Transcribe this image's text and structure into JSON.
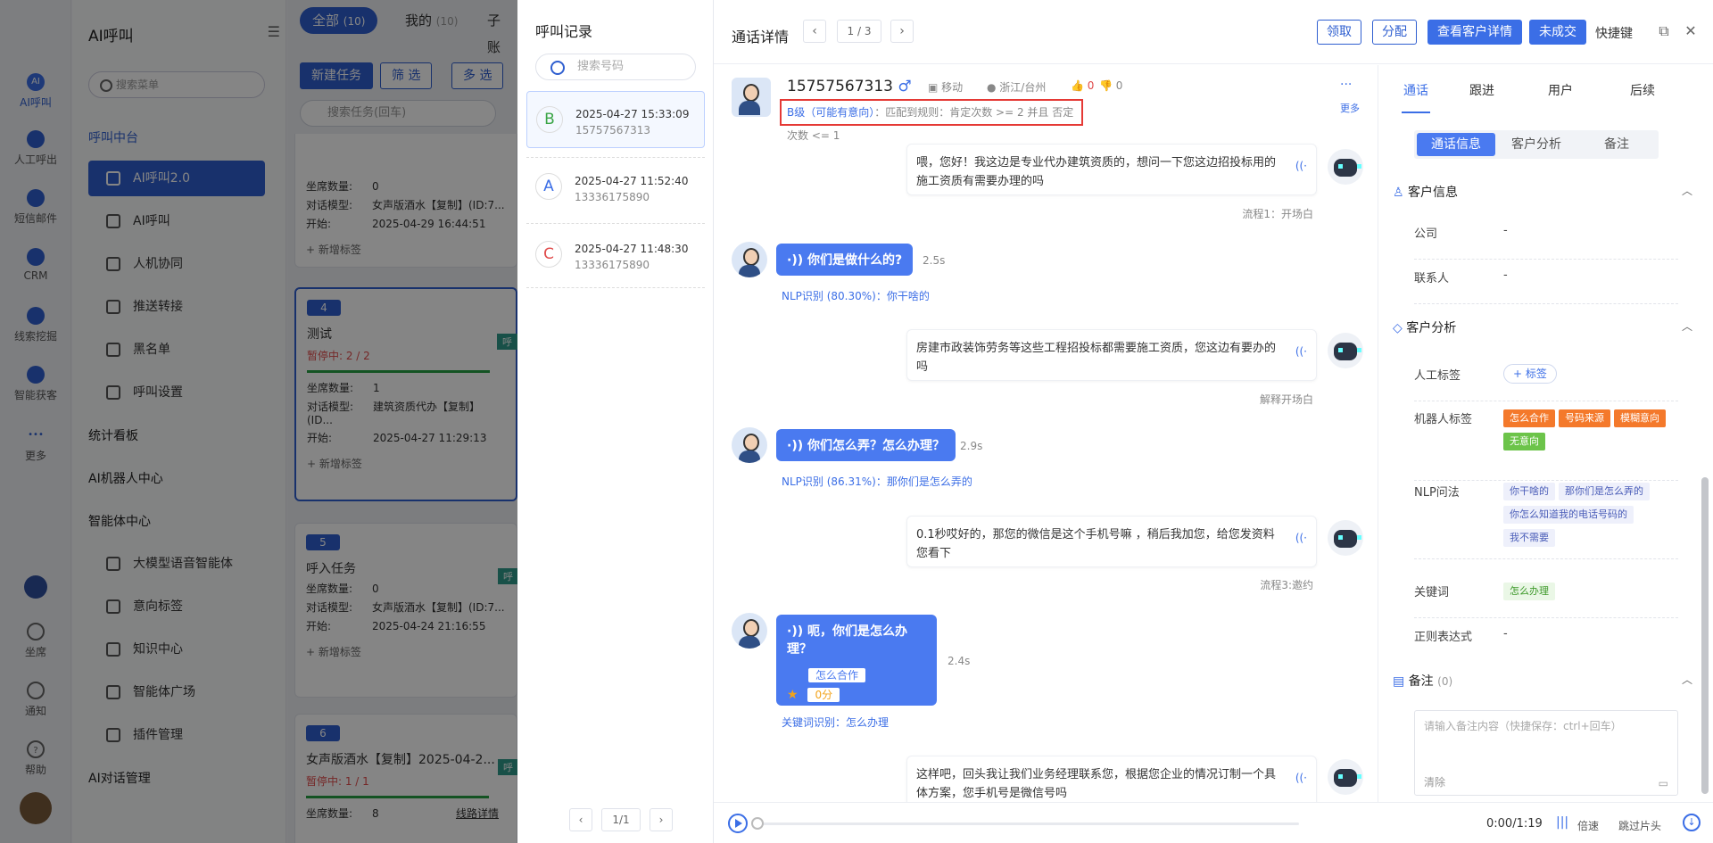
{
  "rail": {
    "items": [
      {
        "label": "AI呼叫",
        "active": true
      },
      {
        "label": "人工呼出"
      },
      {
        "label": "短信邮件"
      },
      {
        "label": "CRM"
      },
      {
        "label": "线索挖掘"
      },
      {
        "label": "智能获客"
      },
      {
        "label": "更多"
      },
      {
        "label": "坐席"
      },
      {
        "label": "通知"
      },
      {
        "label": "帮助"
      }
    ]
  },
  "nav": {
    "title": "AI呼叫",
    "search_placeholder": "搜索菜单",
    "group1": "呼叫中台",
    "items1": [
      "AI呼叫2.0",
      "AI呼叫",
      "人机协同",
      "推送转接",
      "黑名单",
      "呼叫设置"
    ],
    "group2": "统计看板",
    "group3": "AI机器人中心",
    "group4": "智能体中心",
    "items4": [
      "大模型语音智能体",
      "意向标签",
      "知识中心",
      "智能体广场",
      "插件管理"
    ],
    "group5": "AI对话管理"
  },
  "tasks": {
    "tab_all": "全部",
    "tab_all_count": "(10)",
    "tab_mine": "我的",
    "tab_mine_count": "(10)",
    "tab_sub": "子账",
    "btn_new": "新建任务",
    "btn_filter": "筛 选",
    "btn_multi": "多 选",
    "search_placeholder": "搜索任务(回车)",
    "card0": {
      "seats_label": "坐席数量:",
      "seats": "0",
      "model_label": "对话模型:",
      "model": "女声版酒水【复制】(ID:7...",
      "start_label": "开始:",
      "start": "2025-04-29 16:44:51",
      "add": "+ 新增标签"
    },
    "card1": {
      "num": "4",
      "name": "测试",
      "status": "暂停中: 2 / 2",
      "seats_label": "坐席数量:",
      "seats": "1",
      "model_label": "对话模型:",
      "model": "建筑资质代办【复制】(ID...",
      "start_label": "开始:",
      "start": "2025-04-27 11:29:13",
      "add": "+ 新增标签",
      "tag": "呼"
    },
    "card2": {
      "num": "5",
      "name": "呼入任务",
      "seats_label": "坐席数量:",
      "seats": "0",
      "model_label": "对话模型:",
      "model": "女声版酒水【复制】(ID:7...",
      "start_label": "开始:",
      "start": "2025-04-24 21:16:55",
      "add": "+ 新增标签",
      "tag": "呼"
    },
    "card3": {
      "num": "6",
      "name": "女声版酒水【复制】2025-04-2...",
      "status": "暂停中: 1 / 1",
      "seats_label": "坐席数量:",
      "seats": "8",
      "link": "线路详情",
      "tag": "呼"
    }
  },
  "records": {
    "title": "呼叫记录",
    "search_placeholder": "搜索号码",
    "items": [
      {
        "grade": "B",
        "datetime": "2025-04-27 15:33:09",
        "phone": "15757567313",
        "color": "#3aa546"
      },
      {
        "grade": "A",
        "datetime": "2025-04-27 11:52:40",
        "phone": "13336175890",
        "color": "#3b6ee6"
      },
      {
        "grade": "C",
        "datetime": "2025-04-27 11:48:30",
        "phone": "13336175890",
        "color": "#e04b4b"
      }
    ],
    "page": "1/1"
  },
  "detail": {
    "title": "通话详情",
    "page": "1 / 3",
    "btn_claim": "领取",
    "btn_assign": "分配",
    "btn_customer": "查看客户详情",
    "btn_fail": "未成交",
    "shortcut": "快捷键",
    "phone": "15757567313",
    "gender": "♂",
    "carrier": "移动",
    "region": "浙江/台州",
    "likes": "0",
    "dislikes": "0",
    "more": "更多",
    "level": "B级（可能有意向）",
    "rule": "：匹配到规则：肯定次数 >= 2 并且 否定次数 <= 1"
  },
  "chat": [
    {
      "role": "bot",
      "text": "喂，您好！我这边是专业代办建筑资质的，想问一下您这边招投标用的施工资质有需要办理的吗",
      "flow": "流程1：开场白"
    },
    {
      "role": "user",
      "text": "你们是做什么的?",
      "dur": "2.5s",
      "nlp": "NLP识别 (80.30%)：你干啥的"
    },
    {
      "role": "bot",
      "text": "房建市政装饰劳务等这些工程招投标都需要施工资质，您这边有要办的吗",
      "flow": "解释开场白"
    },
    {
      "role": "user",
      "text": "你们怎么弄？怎么办理？",
      "dur": "2.9s",
      "nlp": "NLP识别 (86.31%)：那你们是怎么弄的"
    },
    {
      "role": "bot",
      "text": "0.1秒哎好的，那您的微信是这个手机号嘛 ，稍后我加您，给您发资料您看下",
      "flow": "流程3:邀约"
    },
    {
      "role": "user",
      "text": "呃，你们是怎么办理？",
      "dur": "2.4s",
      "chip": "怎么合作",
      "score": "0分",
      "nlp": "关键词识别：怎么办理"
    },
    {
      "role": "bot",
      "text": "这样吧，回头我让我们业务经理联系您，根据您企业的情况订制一个具体方案，您手机号是微信号吗"
    }
  ],
  "player": {
    "time": "0:00/1:19",
    "speed": "倍速",
    "skip": "跳过片头"
  },
  "side": {
    "tabs": [
      "通话",
      "跟进",
      "用户",
      "后续"
    ],
    "seg": [
      "通话信息",
      "客户分析",
      "备注"
    ],
    "customer_title": "客户信息",
    "company_label": "公司",
    "company": "-",
    "contact_label": "联系人",
    "contact": "-",
    "analysis_title": "客户分析",
    "manual_tag_label": "人工标签",
    "add_tag": "+ 标签",
    "robot_tag_label": "机器人标签",
    "robot_tags": [
      {
        "t": "怎么合作",
        "c": "o"
      },
      {
        "t": "号码来源",
        "c": "o"
      },
      {
        "t": "模糊意向",
        "c": "o"
      },
      {
        "t": "无意向",
        "c": "g"
      }
    ],
    "nlp_label": "NLP问法",
    "nlp_tags": [
      "你干啥的",
      "那你们是怎么弄的",
      "你怎么知道我的电话号码的",
      "我不需要"
    ],
    "keyword_label": "关键词",
    "keyword": "怎么办理",
    "regex_label": "正则表达式",
    "regex": "-",
    "note_title": "备注",
    "note_count": "(0)",
    "note_placeholder": "请输入备注内容（快捷保存：ctrl+回车）",
    "clear": "清除"
  }
}
